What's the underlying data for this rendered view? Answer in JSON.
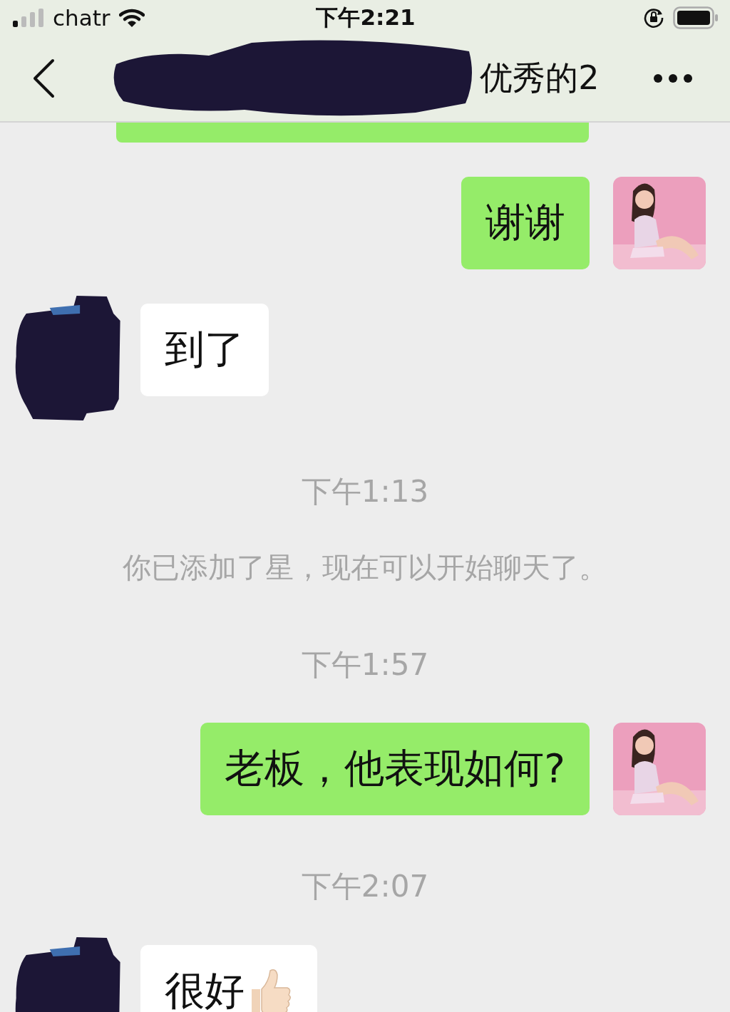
{
  "status_bar": {
    "carrier": "chatr",
    "time": "下午2:21"
  },
  "nav_bar": {
    "title": "优秀的2",
    "title_redacted": true
  },
  "messages": [
    {
      "kind": "clipped"
    },
    {
      "kind": "sent",
      "text": "谢谢"
    },
    {
      "kind": "received",
      "text": "到了"
    },
    {
      "kind": "time",
      "text": "下午1:13"
    },
    {
      "kind": "system",
      "text": "你已添加了星，现在可以开始聊天了。"
    },
    {
      "kind": "time",
      "text": "下午1:57"
    },
    {
      "kind": "sent",
      "text": "老板，他表现如何?"
    },
    {
      "kind": "time",
      "text": "下午2:07"
    },
    {
      "kind": "received",
      "text": "很好",
      "thumbs_up": true
    }
  ]
}
